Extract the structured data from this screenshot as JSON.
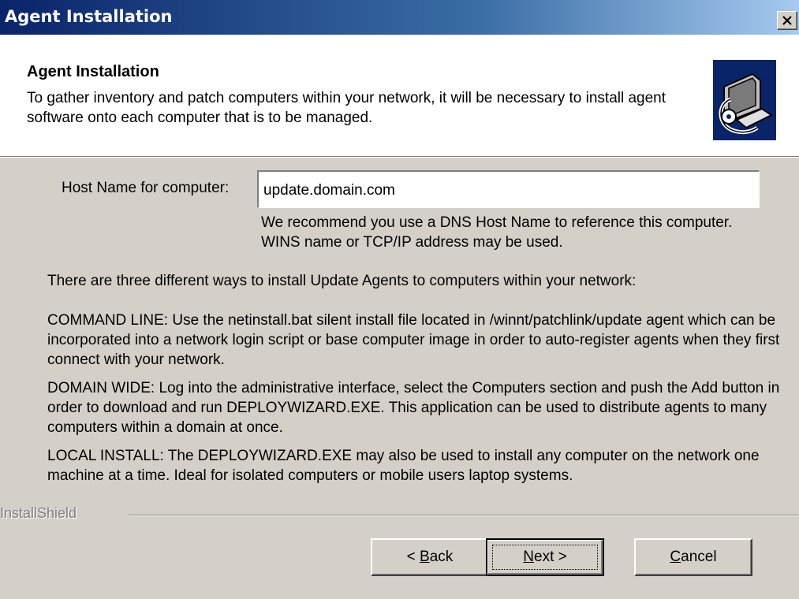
{
  "window": {
    "title": "Agent Installation",
    "close_icon": "close-icon"
  },
  "header": {
    "title": "Agent Installation",
    "description": "To gather inventory and patch computers within your network, it will be necessary to install agent software onto each computer that is to be managed.",
    "logo_icon": "computer-install-icon"
  },
  "form": {
    "host_label": "Host Name for computer:",
    "host_value": "update.domain.com",
    "hint": "We recommend you use a DNS Host Name to reference this computer. WINS name or TCP/IP address may be used."
  },
  "info": {
    "intro": "There are three different ways to install Update Agents to computers within your network:",
    "command_line": "COMMAND LINE: Use the netinstall.bat silent install file located in /winnt/patchlink/update agent which can be incorporated into a network login script or base computer image in order to auto-register agents when they first connect with your network.",
    "domain_wide": "DOMAIN WIDE: Log into the administrative interface, select the Computers section and push the Add button in order to download and run DEPLOYWIZARD.EXE. This application can be used to distribute agents to many computers within a domain at once.",
    "local_install": "LOCAL INSTALL: The DEPLOYWIZARD.EXE may also be used to install any computer on the network one machine at a time. Ideal for isolated computers or mobile users laptop systems."
  },
  "footer": {
    "brand": "InstallShield"
  },
  "buttons": {
    "back": {
      "prefix": "< ",
      "accel": "B",
      "rest": "ack"
    },
    "next": {
      "accel": "N",
      "rest": "ext >"
    },
    "cancel": {
      "accel": "C",
      "rest": "ancel"
    }
  },
  "colors": {
    "title_gradient_start": "#0a246a",
    "title_gradient_end": "#a6caf0",
    "dialog_bg": "#d4d0c8",
    "header_bg": "#ffffff"
  }
}
